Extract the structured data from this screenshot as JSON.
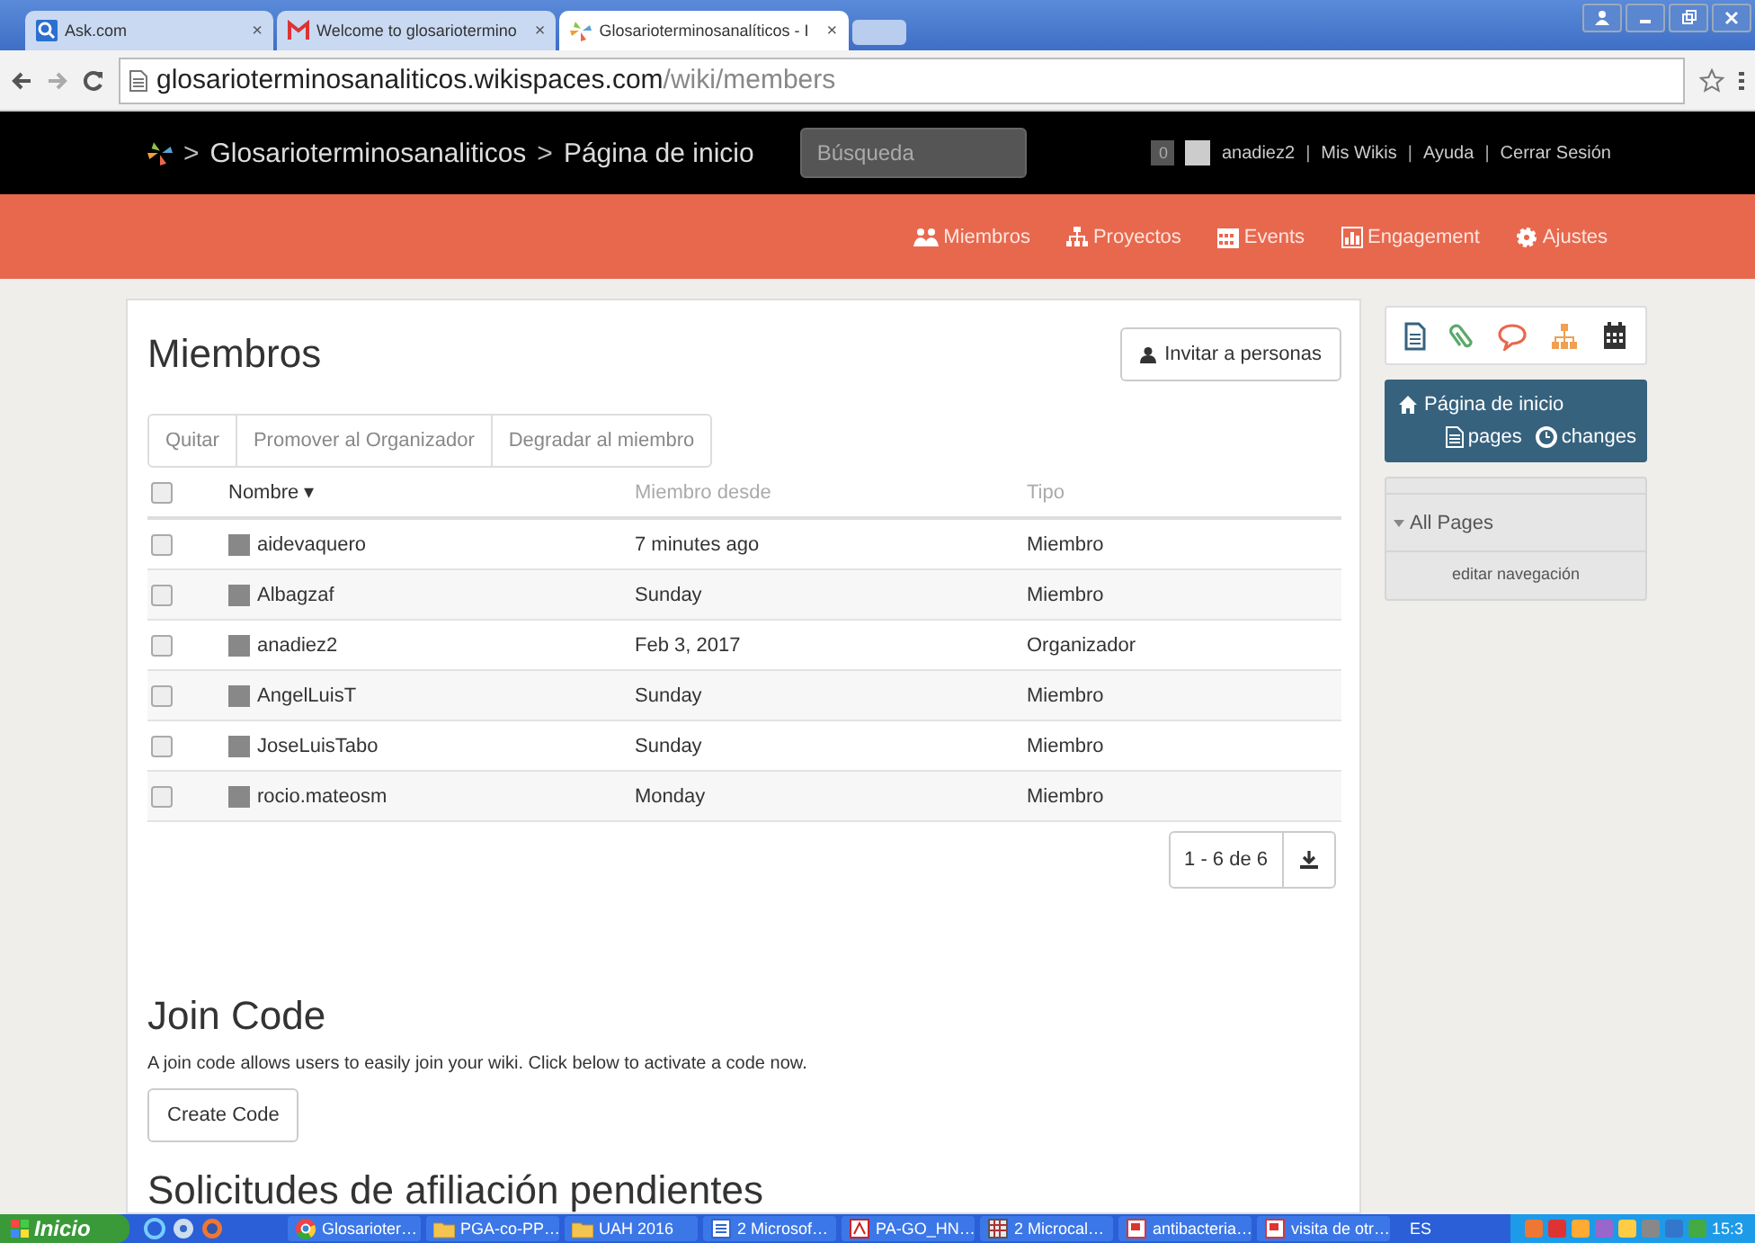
{
  "browser": {
    "tabs": [
      {
        "title": "Ask.com",
        "selected": false
      },
      {
        "title": "Welcome to glosariotermino",
        "selected": false
      },
      {
        "title": "Glosarioterminosanalíticos - I",
        "selected": true
      }
    ],
    "close_label": "×",
    "url_host": "glosarioterminosanaliticos.wikispaces.com",
    "url_path": "/wiki/members"
  },
  "header": {
    "breadcrumb": [
      "Glosarioterminosanaliticos",
      "Página de inicio"
    ],
    "separator": ">",
    "search": {
      "placeholder": "Búsqueda"
    },
    "notifications": "0",
    "user_links": [
      "anadiez2",
      "Mis Wikis",
      "Ayuda",
      "Cerrar Sesión"
    ],
    "link_separator": "|"
  },
  "nav": [
    "Miembros",
    "Proyectos",
    "Events",
    "Engagement",
    "Ajustes"
  ],
  "members": {
    "title": "Miembros",
    "invite_button": "Invitar a personas",
    "actions": [
      "Quitar",
      "Promover al Organizador",
      "Degradar al miembro"
    ],
    "select_all_checked": false,
    "columns": [
      {
        "label": "Nombre",
        "sort_mark": "▾"
      },
      {
        "label": "Miembro desde"
      },
      {
        "label": "Tipo"
      }
    ],
    "rows": [
      {
        "name": "aidevaquero",
        "since": "7 minutes ago",
        "type": "Miembro",
        "checked": false
      },
      {
        "name": "Albagzaf",
        "since": "Sunday",
        "type": "Miembro",
        "checked": false
      },
      {
        "name": "anadiez2",
        "since": "Feb 3, 2017",
        "type": "Organizador",
        "checked": false
      },
      {
        "name": "AngelLuisT",
        "since": "Sunday",
        "type": "Miembro",
        "checked": false
      },
      {
        "name": "JoseLuisTabo",
        "since": "Sunday",
        "type": "Miembro",
        "checked": false
      },
      {
        "name": "rocio.mateosm",
        "since": "Monday",
        "type": "Miembro",
        "checked": false
      }
    ],
    "pagination": "1 - 6 de 6"
  },
  "join_code": {
    "title": "Join Code",
    "text": "A join code allows users to easily join your wiki. Click below to activate a code now.",
    "button": "Create Code"
  },
  "pending": {
    "title": "Solicitudes de afiliación pendientes"
  },
  "sidebar": {
    "home": {
      "title": "Página de inicio",
      "links": [
        "pages",
        "changes"
      ]
    },
    "nav_panel": {
      "heading": "All Pages",
      "edit_link": "editar navegación"
    }
  },
  "taskbar": {
    "start": "Inicio",
    "tasks": [
      "Glosarioter…",
      "PGA-co-PP…",
      "UAH 2016",
      "2 Microsof…",
      "PA-GO_HN…",
      "2 Microcal…",
      "antibacteria…",
      "visita de otr…"
    ],
    "language": "ES",
    "time": "15:3"
  }
}
